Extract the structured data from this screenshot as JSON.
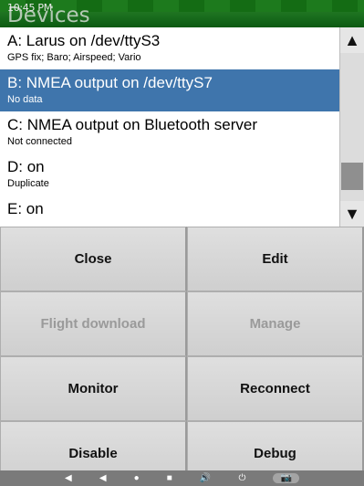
{
  "status_bar": {
    "time": "10:45 PM"
  },
  "window": {
    "title": "Devices"
  },
  "devices": [
    {
      "name": "A: Larus on /dev/ttyS3",
      "status": "GPS fix; Baro; Airspeed; Vario"
    },
    {
      "name": "B: NMEA output on /dev/ttyS7",
      "status": "No data"
    },
    {
      "name": "C: NMEA output on Bluetooth server",
      "status": "Not connected"
    },
    {
      "name": "D:  on",
      "status": "Duplicate"
    },
    {
      "name": "E:  on",
      "status": ""
    }
  ],
  "scrollbar": {
    "up_glyph": "▲",
    "down_glyph": "▼"
  },
  "buttons": {
    "close": "Close",
    "edit": "Edit",
    "flight_download": "Flight download",
    "manage": "Manage",
    "monitor": "Monitor",
    "reconnect": "Reconnect",
    "disable": "Disable",
    "debug": "Debug"
  },
  "navbar": {
    "volume_down": "◀",
    "back": "◀",
    "home": "●",
    "recents": "■",
    "volume_up": "🔊",
    "power": "⏻",
    "screenshot": "📷"
  }
}
